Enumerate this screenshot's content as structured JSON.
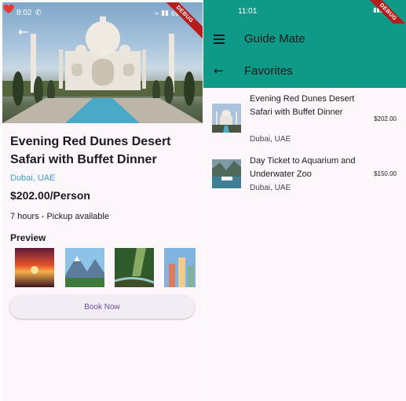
{
  "left": {
    "status": {
      "time": "8:02",
      "battery": "69%"
    },
    "debug_banner": "DEBUG",
    "tour": {
      "title": "Evening Red Dunes Desert Safari with Buffet Dinner",
      "location": "Dubai, UAE",
      "price": "$202.00/Person",
      "duration": "7 hours - Pickup available",
      "preview_heading": "Preview"
    },
    "book_button": "Book Now"
  },
  "right": {
    "status": {
      "time": "11:01"
    },
    "debug_banner": "DEBUG",
    "app_title": "Guide Mate",
    "page_title": "Favorites",
    "favorites": [
      {
        "title": "Evening Red Dunes Desert Safari with Buffet Dinner",
        "location": "Dubai, UAE",
        "price": "$202.00"
      },
      {
        "title": "Day Ticket to Aquarium and Underwater Zoo",
        "location": "Dubai, UAE",
        "price": "$150.00"
      }
    ]
  },
  "colors": {
    "app_bar": "#0f9a88",
    "link": "#3aa1c4",
    "accent": "#6750a4",
    "heart": "#e53935"
  }
}
